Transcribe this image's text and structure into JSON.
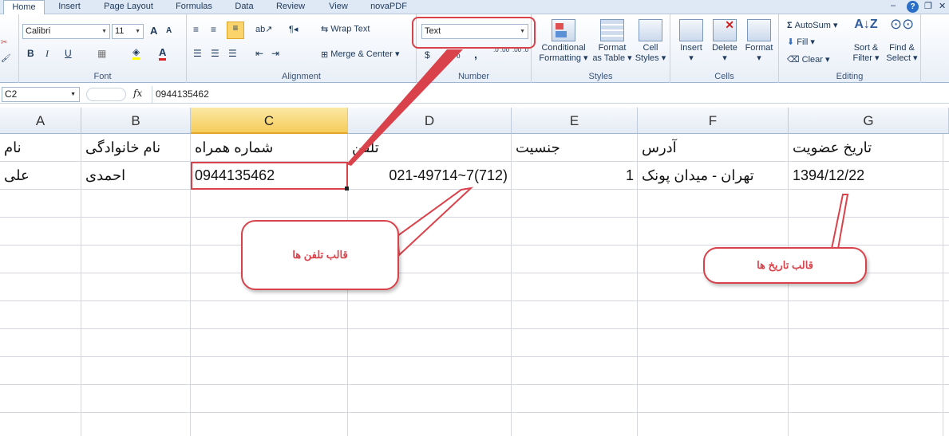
{
  "tabs": [
    "Home",
    "Insert",
    "Page Layout",
    "Formulas",
    "Data",
    "Review",
    "View",
    "novaPDF"
  ],
  "window_controls": {
    "minimize": "–",
    "restore": "❐",
    "close": "✕",
    "help": "?"
  },
  "font_group": {
    "font_name": "Calibri",
    "font_size": "11",
    "bold": "B",
    "italic": "I",
    "underline": "U",
    "grow": "A",
    "shrink": "A",
    "label": "Font"
  },
  "alignment_group": {
    "wrap_text": "Wrap Text",
    "merge_center": "Merge & Center",
    "label": "Alignment"
  },
  "number_group": {
    "format": "Text",
    "currency": "$",
    "percent": "%",
    "comma": ",",
    "inc_decimal": ".0 .00",
    "dec_decimal": ".00 .0",
    "label": "Number"
  },
  "styles_group": {
    "conditional": [
      "Conditional",
      "Formatting"
    ],
    "format_table": [
      "Format",
      "as Table"
    ],
    "cell_styles": [
      "Cell",
      "Styles"
    ],
    "label": "Styles"
  },
  "cells_group": {
    "insert": "Insert",
    "delete": "Delete",
    "format": "Format",
    "label": "Cells"
  },
  "editing_group": {
    "autosum": "AutoSum",
    "fill": "Fill",
    "clear": "Clear",
    "sort": [
      "Sort &",
      "Filter"
    ],
    "find": [
      "Find &",
      "Select"
    ],
    "label": "Editing"
  },
  "formula_bar": {
    "name_box": "C2",
    "fx": "fx",
    "value": "0944135462"
  },
  "columns": [
    "A",
    "B",
    "C",
    "D",
    "E",
    "F",
    "G"
  ],
  "selected_column": "C",
  "rows": [
    {
      "A": "نام",
      "B": "نام خانوادگی",
      "C": "شماره همراه",
      "D": "تلفن",
      "E": "جنسیت",
      "F": "آدرس",
      "G": "تاریخ عضویت"
    },
    {
      "A": "علی",
      "B": "احمدی",
      "C": "0944135462",
      "D": "021-49714~7(712)",
      "E": "1",
      "F": "تهران - میدان پونک",
      "G": "1394/12/22"
    }
  ],
  "annotations": {
    "phone_format": "قالب تلفن ها",
    "date_format": "قالب تاریخ ها"
  },
  "colors": {
    "accent_red": "#d9424a",
    "ribbon_blue": "#dfe9f5",
    "selected_header": "#f5cc5a"
  }
}
